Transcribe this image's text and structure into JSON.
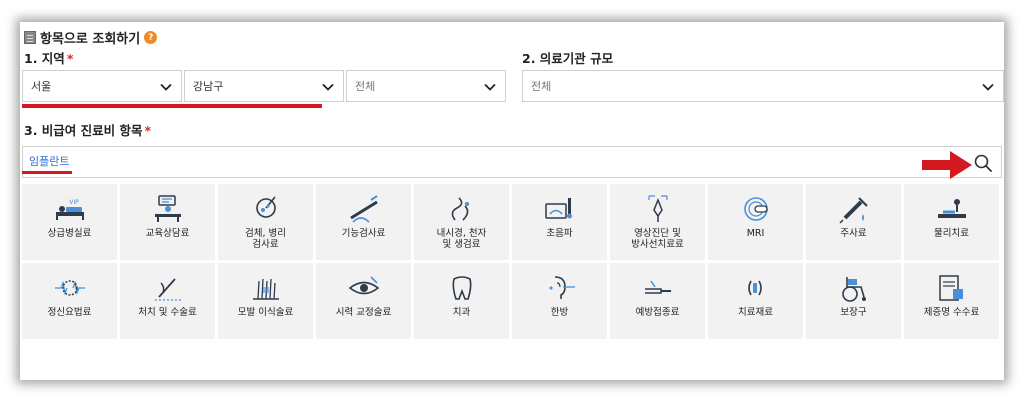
{
  "header": {
    "title": "항목으로 조회하기",
    "help_glyph": "?"
  },
  "region": {
    "label": "1. 지역",
    "required_mark": "*",
    "city": "서울",
    "district": "강남구",
    "dong": "전체"
  },
  "institution": {
    "label": "2. 의료기관 규모",
    "value": "전체"
  },
  "items_section": {
    "label": "3. 비급여 진료비 항목",
    "required_mark": "*",
    "search_value": "임플란트"
  },
  "colors": {
    "accent_red": "#d41820",
    "link_blue": "#2c6bd6",
    "tile_bg": "#f2f2f2",
    "help_orange": "#f08a24"
  },
  "categories": [
    {
      "label": "상급병실료",
      "icon": "hospital-bed-icon"
    },
    {
      "label": "교육상담료",
      "icon": "counseling-icon"
    },
    {
      "label": "검체, 병리\n검사료",
      "icon": "specimen-test-icon"
    },
    {
      "label": "기능검사료",
      "icon": "function-test-icon"
    },
    {
      "label": "내시경, 천자\n및 생검료",
      "icon": "endoscope-icon"
    },
    {
      "label": "초음파",
      "icon": "ultrasound-icon"
    },
    {
      "label": "영상진단 및\n방사선치료료",
      "icon": "imaging-icon"
    },
    {
      "label": "MRI",
      "icon": "mri-icon"
    },
    {
      "label": "주사료",
      "icon": "syringe-icon"
    },
    {
      "label": "물리치료",
      "icon": "physical-therapy-icon"
    },
    {
      "label": "정신요법료",
      "icon": "brain-wave-icon"
    },
    {
      "label": "처치 및 수술료",
      "icon": "surgery-icon"
    },
    {
      "label": "모발 이식술료",
      "icon": "hair-transplant-icon"
    },
    {
      "label": "시력 교정술료",
      "icon": "eye-correction-icon"
    },
    {
      "label": "치과",
      "icon": "tooth-icon"
    },
    {
      "label": "한방",
      "icon": "acupuncture-icon"
    },
    {
      "label": "예방접종료",
      "icon": "vaccination-icon"
    },
    {
      "label": "치료재료",
      "icon": "treatment-material-icon"
    },
    {
      "label": "보장구",
      "icon": "wheelchair-icon"
    },
    {
      "label": "제증명 수수료",
      "icon": "certificate-icon"
    }
  ]
}
